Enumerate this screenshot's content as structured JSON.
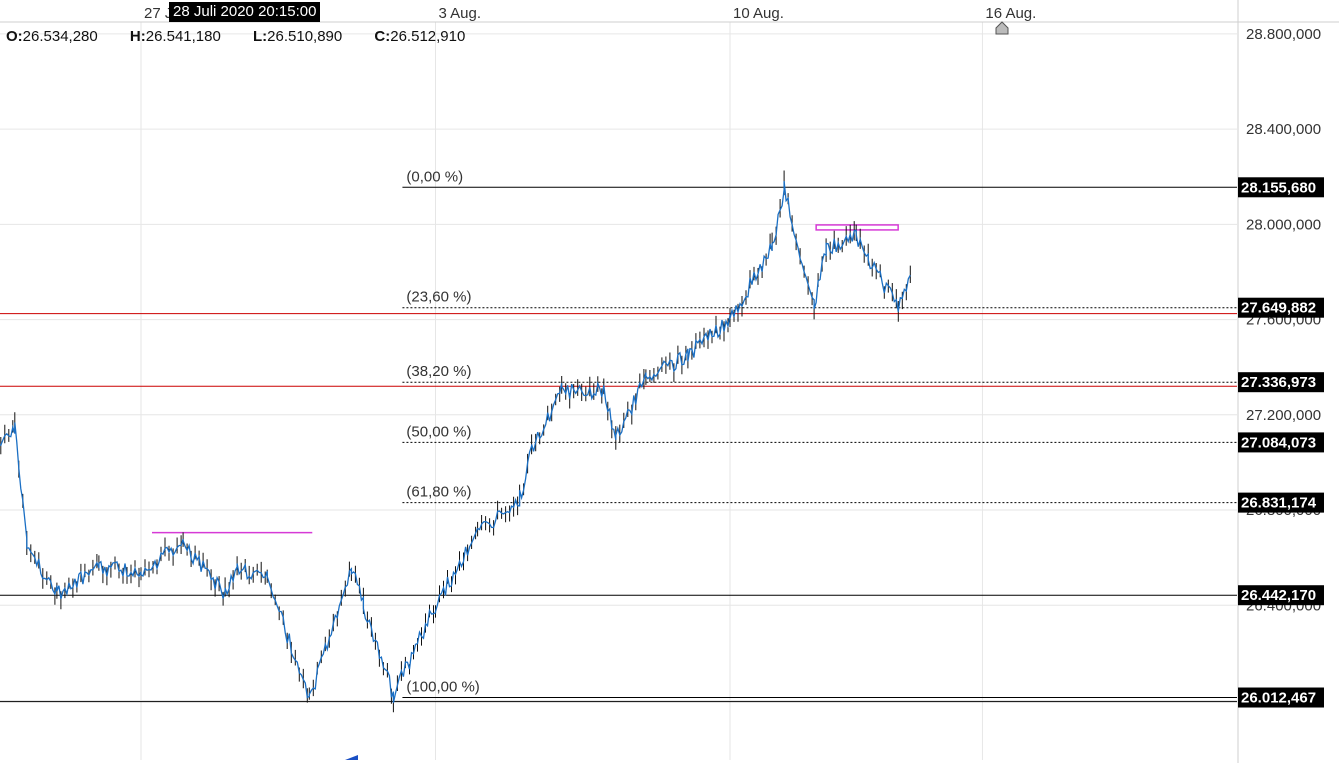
{
  "ohlc": {
    "open_label": "O:",
    "open": "26.534,280",
    "high_label": "H:",
    "high": "26.541,180",
    "low_label": "L:",
    "low": "26.510,890",
    "close_label": "C:",
    "close": "26.512,910"
  },
  "crosshair_time": "28 Juli 2020 20:15:00",
  "x_axis": {
    "labels": [
      {
        "text": "27 J",
        "date": "2020-07-27"
      },
      {
        "text": "3 Aug.",
        "date": "2020-08-03"
      },
      {
        "text": "10 Aug.",
        "date": "2020-08-10"
      },
      {
        "text": "16 Aug.",
        "date": "2020-08-16"
      }
    ]
  },
  "y_axis": {
    "ticks": [
      "28.800,000",
      "28.400,000",
      "28.000,000",
      "27.600,000",
      "27.200,000",
      "26.800,000",
      "26.400,000",
      "26.000,000"
    ],
    "tick_values": [
      28800,
      28400,
      28000,
      27600,
      27200,
      26800,
      26400,
      26000
    ],
    "range": [
      25750,
      28850
    ]
  },
  "chart_data": {
    "type": "line",
    "series": [
      {
        "color": "#1a6fc4",
        "x": [
          "2020-07-23",
          "2020-07-24",
          "2020-07-24",
          "2020-07-25",
          "2020-07-26",
          "2020-07-27",
          "2020-07-28",
          "2020-07-29",
          "2020-07-29",
          "2020-07-30",
          "2020-07-31",
          "2020-08-01",
          "2020-08-01",
          "2020-08-02",
          "2020-08-03",
          "2020-08-04",
          "2020-08-05",
          "2020-08-05",
          "2020-08-06",
          "2020-08-07",
          "2020-08-07",
          "2020-08-08",
          "2020-08-09",
          "2020-08-10",
          "2020-08-11",
          "2020-08-11",
          "2020-08-12",
          "2020-08-12",
          "2020-08-13",
          "2020-08-13",
          "2020-08-14",
          "2020-08-14"
        ],
        "y": [
          26900,
          27150,
          26650,
          26450,
          26550,
          26550,
          26650,
          26450,
          26550,
          26520,
          26000,
          26550,
          26400,
          26020,
          26400,
          26700,
          26850,
          27050,
          27300,
          27300,
          27100,
          27350,
          27450,
          27600,
          27900,
          28150,
          27650,
          27900,
          27950,
          27850,
          27650,
          27800
        ]
      }
    ],
    "fibonacci": [
      {
        "label": "(0,00 %)",
        "value": 28155.68,
        "value_label": "28.155,680"
      },
      {
        "label": "(23,60 %)",
        "value": 27649.882,
        "value_label": "27.649,882"
      },
      {
        "label": "(38,20 %)",
        "value": 27336.973,
        "value_label": "27.336,973"
      },
      {
        "label": "(50,00 %)",
        "value": 27084.073,
        "value_label": "27.084,073"
      },
      {
        "label": "(61,80 %)",
        "value": 26831.174,
        "value_label": "26.831,174"
      },
      {
        "label": "(100,00 %)",
        "value": 26012.467,
        "value_label": "26.012,467"
      }
    ],
    "horizontal_lines": [
      {
        "value": 27625,
        "color": "#cc0000"
      },
      {
        "value": 27320,
        "color": "#cc0000"
      },
      {
        "value": 26442.17,
        "value_label": "26.442,170",
        "color": "#000000"
      },
      {
        "value": 25995,
        "color": "#000000"
      }
    ],
    "magenta_levels": [
      {
        "value": 26705,
        "from": "2020-07-27",
        "to": "2020-07-31"
      },
      {
        "value": 27985,
        "from": "2020-08-12",
        "to": "2020-08-14"
      }
    ]
  }
}
